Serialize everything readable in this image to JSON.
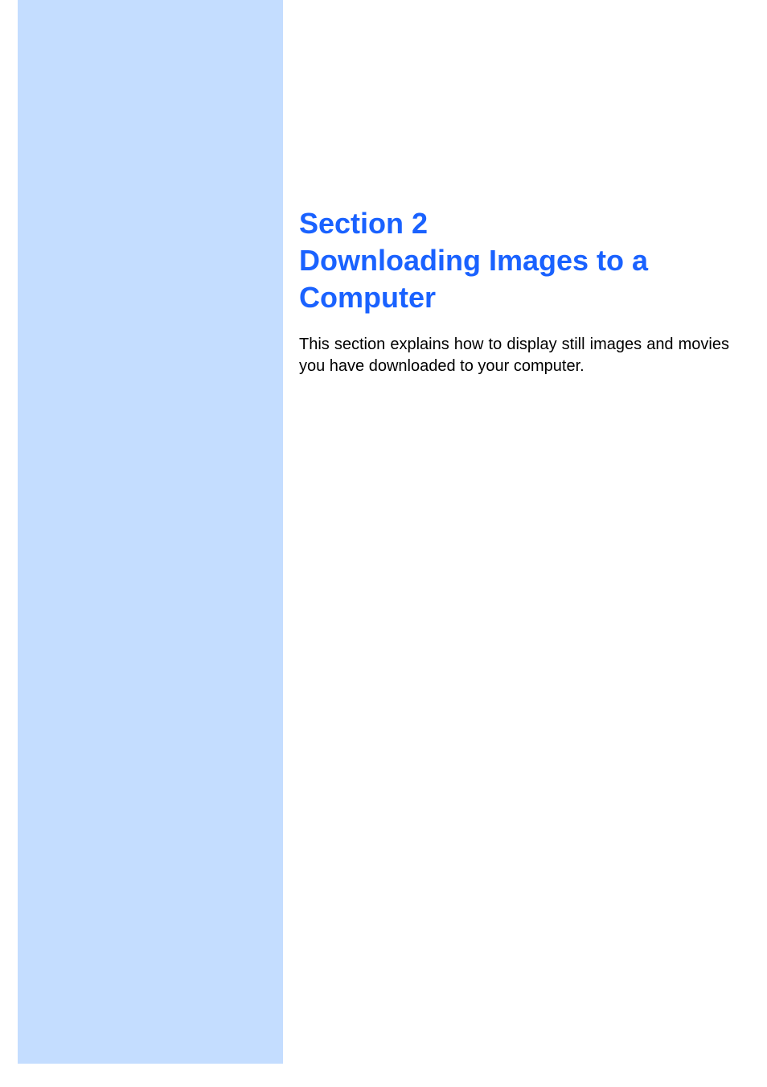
{
  "heading": {
    "section_label": "Section 2",
    "title_line1": "Downloading Images to a",
    "title_line2": "Computer"
  },
  "body": {
    "paragraph": "This section explains how to display still images and mov­ies you have downloaded to your computer."
  }
}
